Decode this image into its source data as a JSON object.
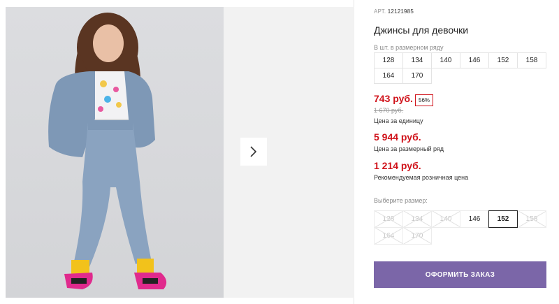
{
  "product": {
    "sku_label": "АРТ.",
    "sku": "12121985",
    "title": "Джинсы для девочки"
  },
  "size_row": {
    "label": "В шт. в размерном ряду",
    "sizes": [
      "128",
      "134",
      "140",
      "146",
      "152",
      "158",
      "164",
      "170"
    ]
  },
  "pricing": {
    "unit_price": "743 руб.",
    "discount_badge": "56%",
    "old_price": "1 670 руб.",
    "unit_note": "Цена за единицу",
    "row_price": "5 944 руб.",
    "row_note": "Цена за размерный ряд",
    "rrp_price": "1 214 руб.",
    "rrp_note": "Рекомендуемая розничная цена"
  },
  "size_picker": {
    "label": "Выберите размер:",
    "options": [
      {
        "value": "128",
        "state": "disabled"
      },
      {
        "value": "134",
        "state": "disabled"
      },
      {
        "value": "140",
        "state": "disabled"
      },
      {
        "value": "146",
        "state": "available"
      },
      {
        "value": "152",
        "state": "selected"
      },
      {
        "value": "158",
        "state": "disabled"
      },
      {
        "value": "164",
        "state": "disabled"
      },
      {
        "value": "170",
        "state": "disabled"
      }
    ]
  },
  "actions": {
    "order_label": "ОФОРМИТЬ ЗАКАЗ"
  },
  "gallery": {
    "next_icon": "chevron-right-icon"
  },
  "colors": {
    "price_red": "#d0131b",
    "order_button": "#7b66a8"
  }
}
